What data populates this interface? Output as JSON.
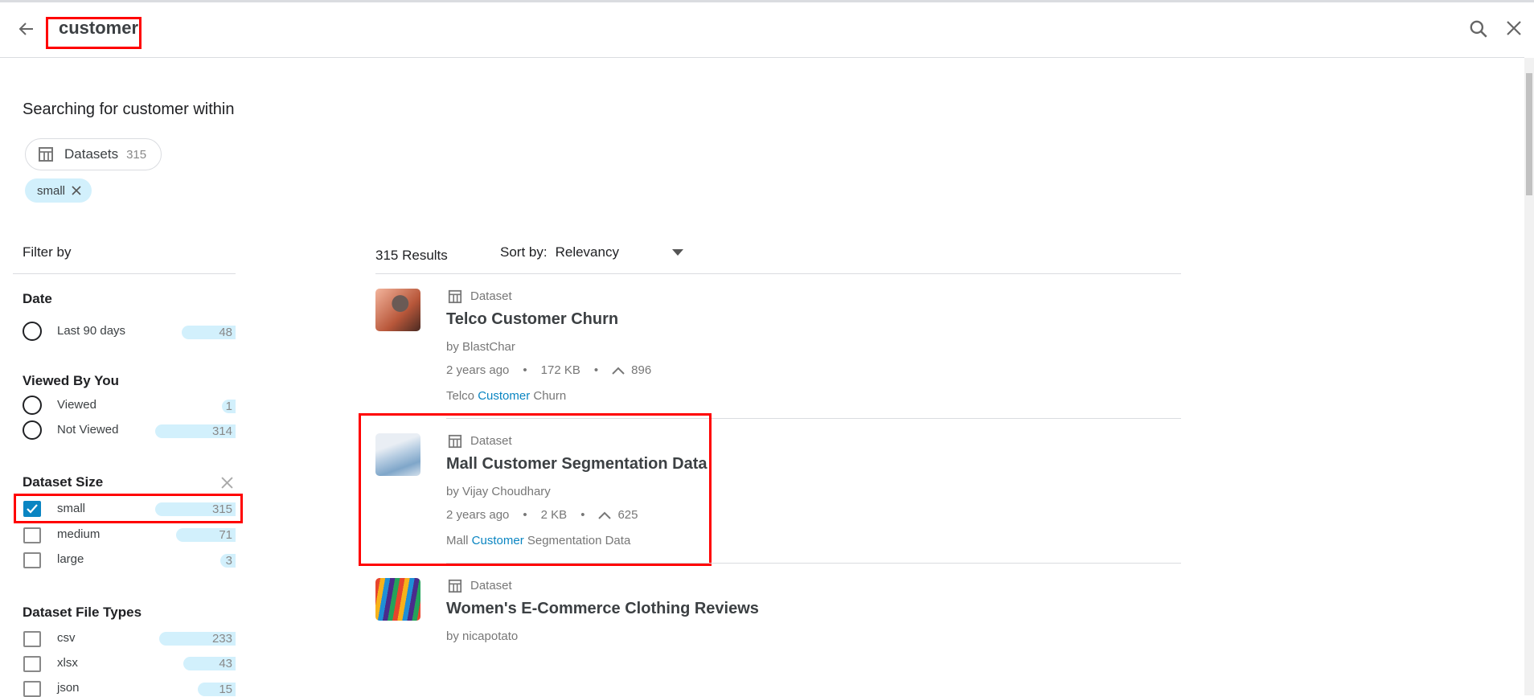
{
  "header": {
    "query": "customer",
    "back_icon": "arrow-left-icon",
    "search_icon": "search-icon",
    "close_icon": "close-icon"
  },
  "scope": {
    "heading": "Searching for customer within",
    "datasets_label": "Datasets",
    "datasets_count": "315",
    "active_filter": "small"
  },
  "filters": {
    "title": "Filter by",
    "groups": [
      {
        "heading": "Date",
        "options": [
          {
            "label": "Last 90 days",
            "count": "48"
          }
        ]
      },
      {
        "heading": "Viewed By You",
        "options": [
          {
            "label": "Viewed",
            "count": "1"
          },
          {
            "label": "Not Viewed",
            "count": "314"
          }
        ]
      },
      {
        "heading": "Dataset Size",
        "options": [
          {
            "label": "small",
            "count": "315",
            "checked": true
          },
          {
            "label": "medium",
            "count": "71"
          },
          {
            "label": "large",
            "count": "3"
          }
        ]
      },
      {
        "heading": "Dataset File Types",
        "options": [
          {
            "label": "csv",
            "count": "233"
          },
          {
            "label": "xlsx",
            "count": "43"
          },
          {
            "label": "json",
            "count": "15"
          }
        ]
      }
    ]
  },
  "results": {
    "count_label": "315 Results",
    "sort_label": "Sort by:",
    "sort_value": "Relevancy",
    "items": [
      {
        "type": "Dataset",
        "title": "Telco Customer Churn",
        "author": "by BlastChar",
        "age": "2 years ago",
        "size": "172 KB",
        "votes": "896",
        "snippet_pre": "Telco ",
        "snippet_hl": "Customer",
        "snippet_post": " Churn"
      },
      {
        "type": "Dataset",
        "title": "Mall Customer Segmentation Data",
        "author": "by Vijay Choudhary",
        "age": "2 years ago",
        "size": "2 KB",
        "votes": "625",
        "snippet_pre": "Mall ",
        "snippet_hl": "Customer",
        "snippet_post": " Segmentation Data"
      },
      {
        "type": "Dataset",
        "title": "Women's E-Commerce Clothing Reviews",
        "author": "by nicapotato"
      }
    ]
  },
  "colors": {
    "accent": "#0a85c2",
    "count_bar": "#d2f0fc",
    "highlight_box": "#ff0000"
  }
}
